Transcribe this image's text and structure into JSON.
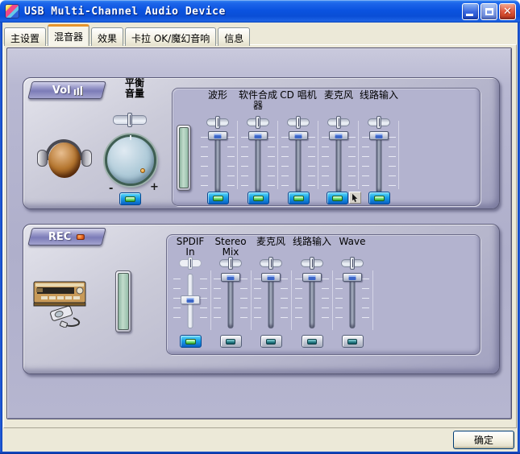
{
  "window": {
    "title": "USB Multi-Channel Audio Device",
    "controls": {
      "minimize": "minimize-button",
      "maximize": "maximize-button-disabled",
      "close": "close-button"
    }
  },
  "tabs": [
    {
      "label": "主设置",
      "active": false
    },
    {
      "label": "混音器",
      "active": true
    },
    {
      "label": "效果",
      "active": false
    },
    {
      "label": "卡拉 OK/魔幻音响",
      "active": false
    },
    {
      "label": "信息",
      "active": false
    }
  ],
  "volume_section": {
    "badge": "Vol",
    "balance_label": "平衡",
    "volume_label": "音量",
    "knob_min": "-",
    "knob_max": "+",
    "channels": [
      {
        "line1": "波形",
        "line2": "",
        "level": "max",
        "muted": false
      },
      {
        "line1": "软件合成",
        "line2": "器",
        "level": "max",
        "muted": false
      },
      {
        "line1": "CD 唱机",
        "line2": "",
        "level": "max",
        "muted": false
      },
      {
        "line1": "麦克风",
        "line2": "",
        "level": "max",
        "muted": false,
        "advanced_button": true
      },
      {
        "line1": "线路输入",
        "line2": "",
        "level": "max",
        "muted": false
      }
    ]
  },
  "record_section": {
    "badge": "REC",
    "channels": [
      {
        "line1": "SPDIF",
        "line2": "In",
        "level": "mid",
        "selected": true,
        "disabled": true
      },
      {
        "line1": "Stereo",
        "line2": "Mix",
        "level": "max",
        "selected": false
      },
      {
        "line1": "麦克风",
        "line2": "",
        "level": "max",
        "selected": false
      },
      {
        "line1": "线路输入",
        "line2": "",
        "level": "max",
        "selected": false
      },
      {
        "line1": "Wave",
        "line2": "",
        "level": "max",
        "selected": false
      }
    ]
  },
  "footer": {
    "ok_label": "确定"
  },
  "colors": {
    "titlebar_blue": "#0B53E0",
    "dialog_beige": "#ECE9D8",
    "panel_lavender": "#B3B3CF",
    "badge_purple": "#8A8AC0",
    "button_cyan": "#18A0E8",
    "led_green": "#74E274",
    "led_teal": "#1E747E",
    "meter_teal": "#A2C6B4",
    "close_red": "#E25A40",
    "active_tab_orange": "#E5942C"
  }
}
